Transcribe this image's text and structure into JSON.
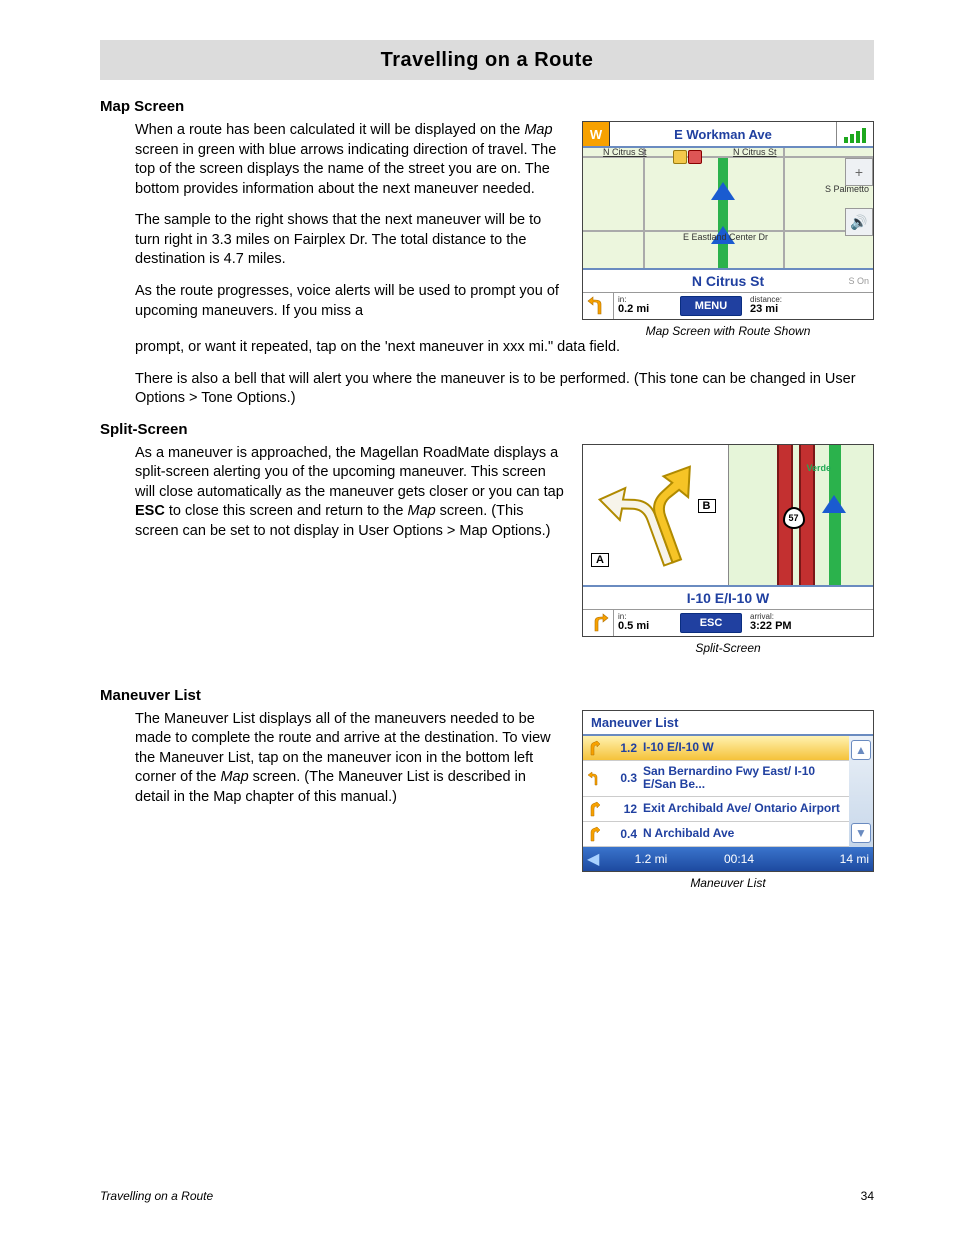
{
  "title": "Travelling on a Route",
  "sec1": {
    "heading": "Map Screen",
    "p1a": "When a route has been calculated it will be displayed on the ",
    "p1_map": "Map",
    "p1b": " screen in green with blue arrows indicating direction of travel.  The top of the screen displays the name of the street you are on.  The bottom provides information about the next maneuver needed.",
    "p2": "The sample to the right shows that the next maneuver will be to turn right in 3.3 miles on Fairplex Dr.  The total distance to the destination is 4.7 miles.",
    "p3": "As the route progresses, voice alerts will be used to prompt you of upcoming maneuvers.  If you miss a prompt, or want it repeated, tap on the 'next maneuver in xxx mi.\" data field.",
    "p4": "There is also a bell that will alert you where the maneuver is to be performed. (This tone can be changed in User Options >  Tone Options.)"
  },
  "mapfig": {
    "compass": "W",
    "top_street": "E Workman Ave",
    "label_citrus_l": "N Citrus St",
    "label_citrus_r": "N Citrus St",
    "label_palmetto": "S Palmetto",
    "label_eastland": "E Eastland Center Dr",
    "mid_street": "N Citrus St",
    "mid_right": "S On",
    "in_lbl": "in:",
    "in_val": "0.2 mi",
    "menu": "MENU",
    "dist_lbl": "distance:",
    "dist_val": "23 mi",
    "caption": "Map Screen with Route Shown"
  },
  "sec2": {
    "heading": "Split-Screen",
    "p1a": "As a maneuver is approached, the Magellan RoadMate displays a split-screen alerting you of the upcoming maneuver. This screen will close automatically as the maneuver gets closer or you can tap ",
    "p1_esc": "ESC",
    "p1b": " to close this screen and return to the ",
    "p1_map": "Map",
    "p1c": " screen. (This screen can be set to not display in User Options > Map Options.)"
  },
  "splitfig": {
    "label_a": "A",
    "label_b": "B",
    "label_verde": "Verde",
    "shield_57": "57",
    "mid": "I-10 E/I-10 W",
    "in_lbl": "in:",
    "in_val": "0.5 mi",
    "esc": "ESC",
    "arr_lbl": "arrival:",
    "arr_val": "3:22 PM",
    "caption": "Split-Screen"
  },
  "sec3": {
    "heading": "Maneuver List",
    "p1a": "The Maneuver List displays all of the maneuvers needed to be made to complete the route and arrive at the destination.  To view the Maneuver List, tap on the maneuver icon in the bottom left corner of the ",
    "p1_map": "Map",
    "p1b": " screen.   (The Maneuver List is described in detail in the Map chapter of this manual.)"
  },
  "mlist": {
    "title": "Maneuver List",
    "rows": [
      {
        "dist": "1.2",
        "text": "I-10 E/I-10 W"
      },
      {
        "dist": "0.3",
        "text": "San Bernardino Fwy East/ I-10 E/San Be..."
      },
      {
        "dist": "12",
        "text": "Exit Archibald Ave/ Ontario Airport"
      },
      {
        "dist": "0.4",
        "text": "N Archibald Ave"
      }
    ],
    "footer_dist": "1.2 mi",
    "footer_time": "00:14",
    "footer_total": "14 mi",
    "caption": "Maneuver List"
  },
  "footer": {
    "title": "Travelling on a Route",
    "page": "34"
  }
}
